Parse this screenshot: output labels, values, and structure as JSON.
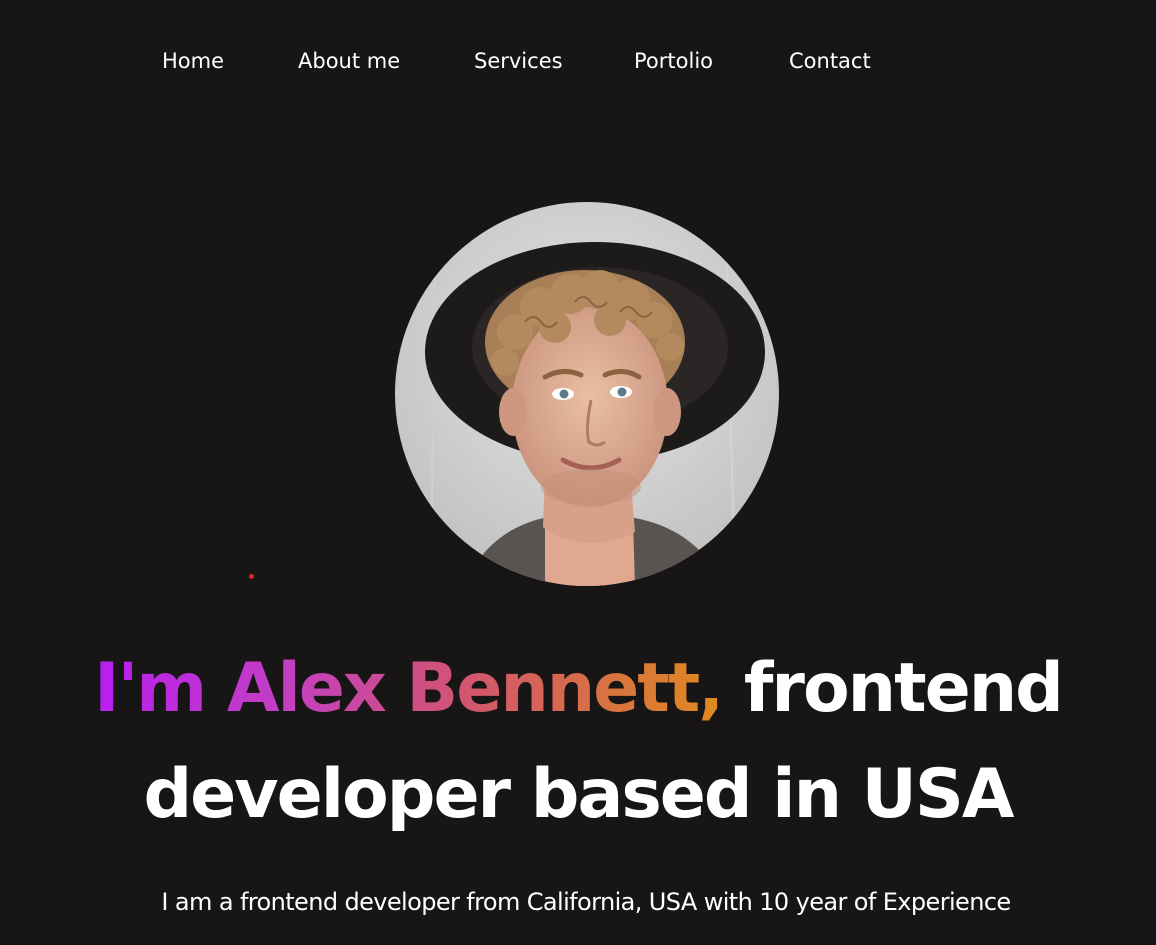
{
  "nav": {
    "items": [
      {
        "label": "Home"
      },
      {
        "label": "About me"
      },
      {
        "label": "Services"
      },
      {
        "label": "Portolio"
      },
      {
        "label": "Contact"
      }
    ]
  },
  "hero": {
    "avatar_icon": "profile-photo",
    "headline_name": "I'm Alex Bennett,",
    "headline_role": "frontend",
    "headline_line2": "developer based in USA",
    "subtitle": "I am a frontend developer from California, USA with 10 year of Experience"
  },
  "colors": {
    "background": "#171515",
    "gradient_start": "#b71ff0",
    "gradient_end": "#df8a1c",
    "text": "#ffffff"
  }
}
